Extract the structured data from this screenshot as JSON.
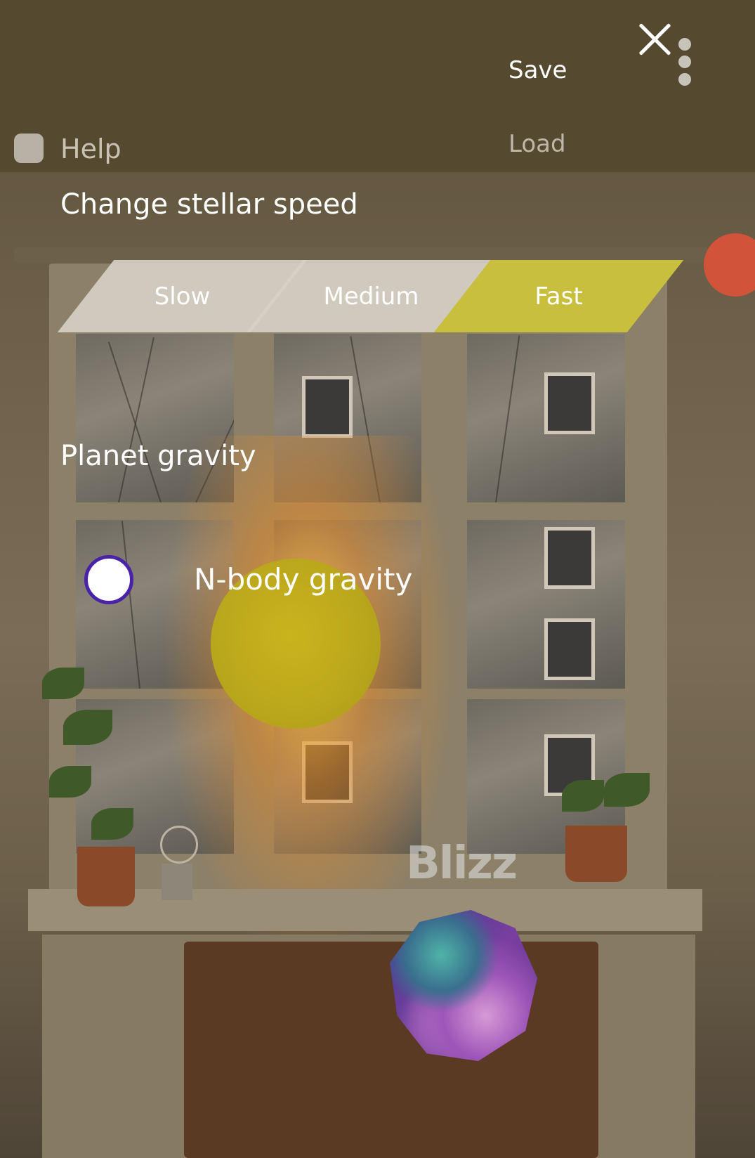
{
  "header": {
    "save_label": "Save",
    "load_label": "Load",
    "close_icon": "close-icon",
    "more_icon": "more-vertical-icon"
  },
  "help": {
    "label": "Help",
    "checked": false
  },
  "stellar_speed": {
    "title": "Change stellar speed",
    "options": [
      {
        "label": "Slow",
        "selected": false
      },
      {
        "label": "Medium",
        "selected": false
      },
      {
        "label": "Fast",
        "selected": true
      }
    ]
  },
  "planet_gravity": {
    "title": "Planet gravity",
    "option_label": "N-body gravity",
    "selected": true
  },
  "scene": {
    "watermark": "Blizz"
  },
  "colors": {
    "selected_speed": "#c9bf3e",
    "unselected_speed": "#cfcac2",
    "radio_border": "#4a22a8",
    "sun": "#b9a81a"
  }
}
